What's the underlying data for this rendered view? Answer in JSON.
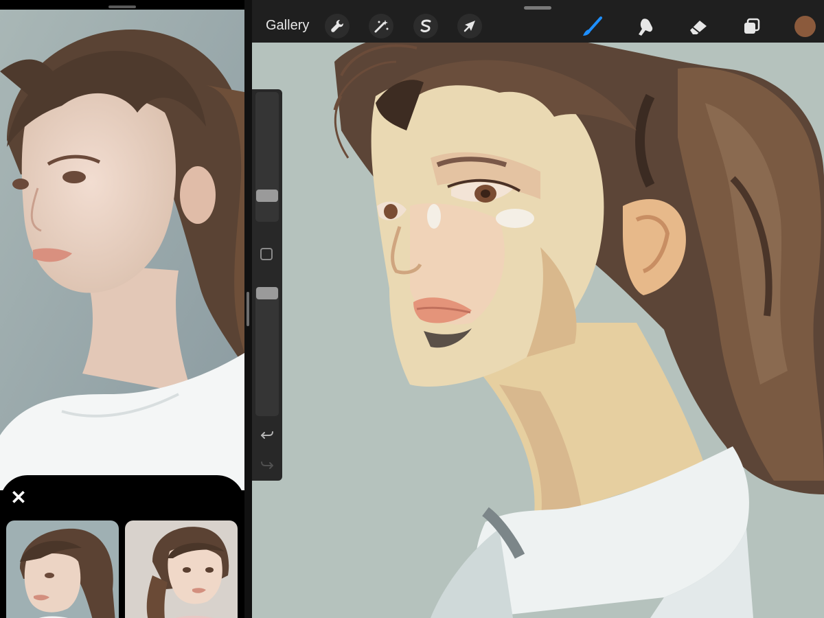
{
  "toolbar": {
    "gallery_label": "Gallery",
    "left_tools": [
      "wrench-icon",
      "magic-wand-icon",
      "selection-s-icon",
      "arrow-cursor-icon"
    ],
    "right_tools": [
      "brush-icon",
      "smudge-icon",
      "eraser-icon",
      "layers-icon"
    ],
    "active_tool": "brush",
    "current_color": "#8b5a3c",
    "accent_color": "#1e8fff"
  },
  "sidebar": {
    "controls": [
      "brush-size-slider",
      "modify-square-button",
      "opacity-slider",
      "undo-arrow-icon",
      "redo-arrow-icon"
    ],
    "brush_size_level": 0.17,
    "opacity_level": 1.0
  },
  "reference": {
    "close_icon": "x-icon",
    "thumbnail_count": 2
  },
  "colors": {
    "canvas_background": "#b5c2bd",
    "toolbar_background": "#1f1f1f",
    "sidebar_background": "#282828"
  }
}
